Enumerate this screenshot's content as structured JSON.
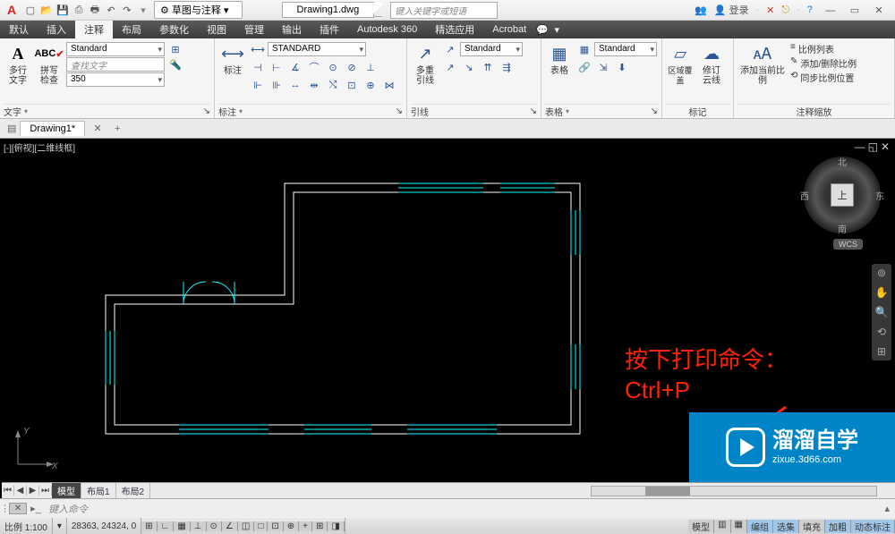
{
  "title": {
    "doc": "Drawing1.dwg",
    "workspace": "草图与注释",
    "search_ph": "键入关键字或短语",
    "login": "登录"
  },
  "qat": [
    "new",
    "open",
    "save",
    "saveas",
    "print",
    "undo",
    "redo"
  ],
  "menu": {
    "tabs": [
      "默认",
      "插入",
      "注释",
      "布局",
      "参数化",
      "视图",
      "管理",
      "输出",
      "插件",
      "Autodesk 360",
      "精选应用",
      "Acrobat"
    ],
    "active": 2
  },
  "ribbon": {
    "text": {
      "label": "文字",
      "mtext": "多行文字",
      "spell": "拼写检查",
      "find_ph": "查找文字",
      "height": "350"
    },
    "dim": {
      "label": "标注",
      "style": "STANDARD",
      "btn": "标注"
    },
    "leader": {
      "label": "引线",
      "style": "Standard",
      "btn": "多重引线"
    },
    "table": {
      "label": "表格",
      "style": "Standard",
      "btn": "表格"
    },
    "markup": {
      "label": "标记",
      "wipeout": "区域覆盖",
      "revcloud": "修订云线"
    },
    "scale": {
      "label": "注释缩放",
      "add": "添加当前比例",
      "list": "比例列表",
      "edit": "添加/删除比例",
      "sync": "同步比例位置"
    }
  },
  "filetab": "Drawing1*",
  "viewport": {
    "label": "[-][俯视][二维线框]",
    "compass": {
      "n": "北",
      "s": "南",
      "e": "东",
      "w": "西",
      "top": "上"
    },
    "wcs": "WCS"
  },
  "annotation": {
    "line1": "按下打印命令：",
    "line2": "Ctrl+P"
  },
  "bottom_tabs": {
    "items": [
      "模型",
      "布局1",
      "布局2"
    ],
    "active": 0
  },
  "cmd": {
    "placeholder": "键入命令"
  },
  "status": {
    "scale": "比例 1:100",
    "coords": "28363, 24324, 0",
    "toggles": [
      "编组",
      "选集",
      "填充",
      "加粗",
      "动态标注"
    ],
    "left_icons": [
      "⊞",
      "∟",
      "▦",
      "⊥",
      "⊙",
      "∠",
      "◫",
      "□",
      "⊡",
      "⊕",
      "+",
      "⊞",
      "◨"
    ]
  },
  "watermark": {
    "title": "溜溜自学",
    "url": "zixue.3d66.com"
  }
}
